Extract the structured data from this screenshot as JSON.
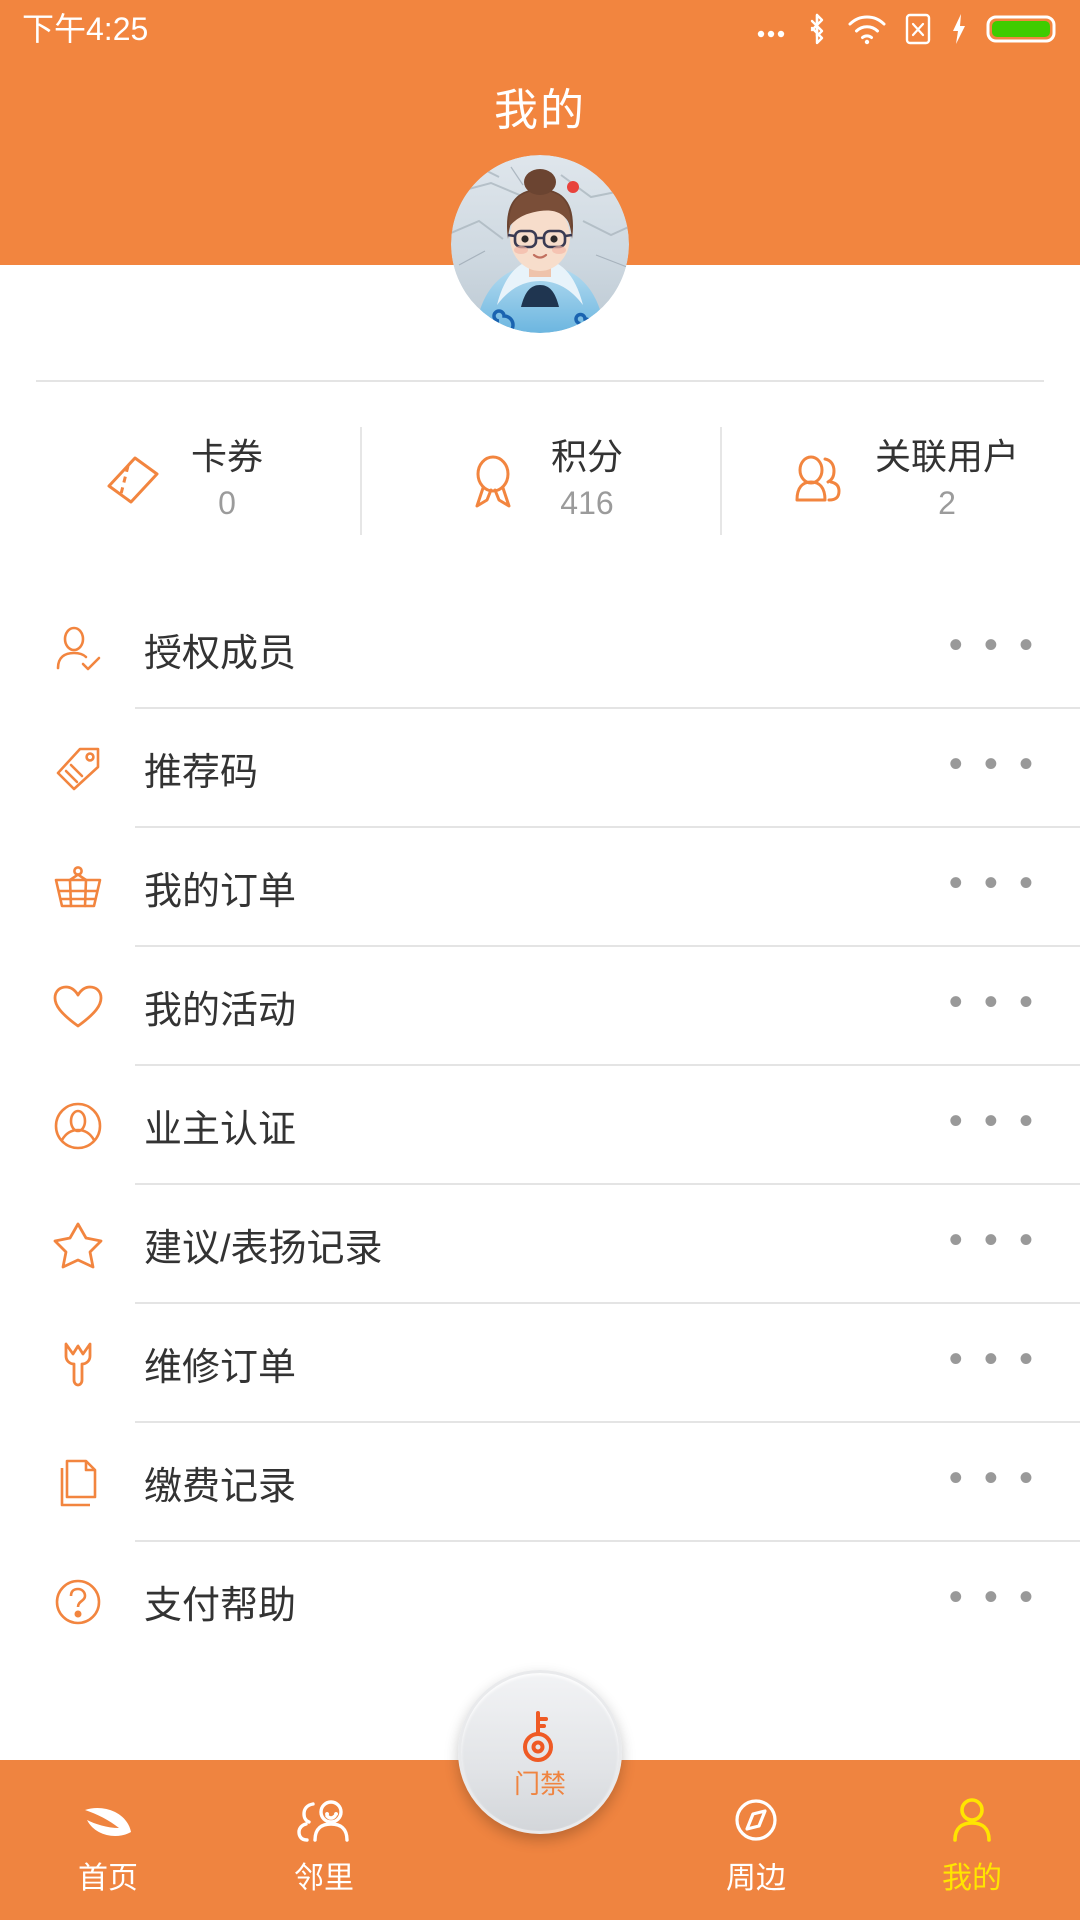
{
  "statusbar": {
    "time": "下午4:25",
    "icons": [
      "more-dots-icon",
      "bluetooth-icon",
      "wifi-icon",
      "sim-x-icon",
      "charging-bolt-icon",
      "battery-icon"
    ],
    "battery_color": "#3fcc00"
  },
  "header": {
    "title": "我的",
    "background_color": "#f2853f",
    "avatar_alt": "user-avatar"
  },
  "stats": [
    {
      "icon": "coupon-ticket-icon",
      "label": "卡券",
      "value": "0"
    },
    {
      "icon": "award-medal-icon",
      "label": "积分",
      "value": "416"
    },
    {
      "icon": "linked-users-icon",
      "label": "关联用户",
      "value": "2"
    }
  ],
  "menu": {
    "more_dots": "• • •",
    "items": [
      {
        "icon": "user-check-icon",
        "label": "授权成员"
      },
      {
        "icon": "tag-icon",
        "label": "推荐码"
      },
      {
        "icon": "basket-icon",
        "label": "我的订单"
      },
      {
        "icon": "heart-icon",
        "label": "我的活动"
      },
      {
        "icon": "owner-verify-icon",
        "label": "业主认证"
      },
      {
        "icon": "star-icon",
        "label": "建议/表扬记录"
      },
      {
        "icon": "wrench-icon",
        "label": "维修订单"
      },
      {
        "icon": "document-icon",
        "label": "缴费记录"
      },
      {
        "icon": "payment-help-icon",
        "label": "支付帮助"
      }
    ]
  },
  "tabbar": {
    "background_color": "#ef8440",
    "active_color": "#ffe500",
    "items": [
      {
        "icon": "home-leaf-icon",
        "label": "首页",
        "active": false
      },
      {
        "icon": "neighbors-icon",
        "label": "邻里",
        "active": false
      },
      {
        "icon": "compass-icon",
        "label": "周边",
        "active": false
      },
      {
        "icon": "profile-person-icon",
        "label": "我的",
        "active": true
      }
    ],
    "fab": {
      "icon": "door-key-icon",
      "label": "门禁"
    }
  }
}
